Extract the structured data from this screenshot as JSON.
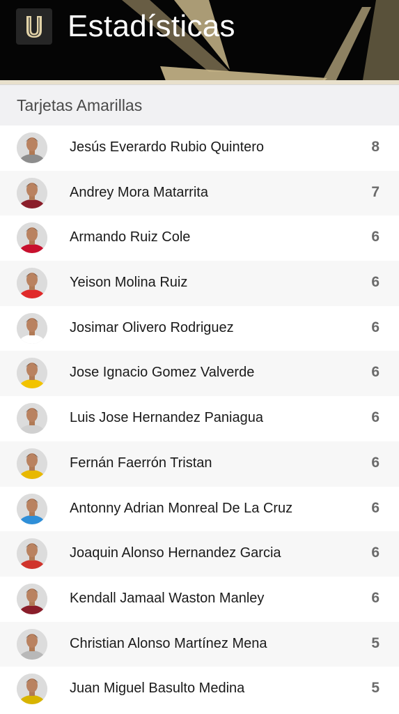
{
  "header": {
    "title": "Estadísticas",
    "logo_letter": "U",
    "background": "#050505",
    "accent": "#c8b68a"
  },
  "section": {
    "title": "Tarjetas Amarillas"
  },
  "players": [
    {
      "name": "Jesús Everardo Rubio Quintero",
      "count": "8",
      "jersey": "#8d8d8d"
    },
    {
      "name": "Andrey Mora Matarrita",
      "count": "7",
      "jersey": "#8a1e2a"
    },
    {
      "name": "Armando Ruiz Cole",
      "count": "6",
      "jersey": "#c8102e"
    },
    {
      "name": "Yeison Molina Ruiz",
      "count": "6",
      "jersey": "#e02a2a"
    },
    {
      "name": "Josimar Olivero Rodriguez",
      "count": "6",
      "jersey": "#ffffff"
    },
    {
      "name": "Jose Ignacio Gomez Valverde",
      "count": "6",
      "jersey": "#f2c300"
    },
    {
      "name": "Luis Jose Hernandez Paniagua",
      "count": "6",
      "jersey": "#d0d0d0"
    },
    {
      "name": "Fernán Faerrón Tristan",
      "count": "6",
      "jersey": "#e8b800"
    },
    {
      "name": "Antonny Adrian Monreal De La Cruz",
      "count": "6",
      "jersey": "#2f8fd8"
    },
    {
      "name": "Joaquin Alonso Hernandez Garcia",
      "count": "6",
      "jersey": "#d0342c"
    },
    {
      "name": "Kendall Jamaal Waston Manley",
      "count": "6",
      "jersey": "#8a1e2a"
    },
    {
      "name": "Christian Alonso Martínez Mena",
      "count": "5",
      "jersey": "#b8b8b8"
    },
    {
      "name": "Juan Miguel Basulto Medina",
      "count": "5",
      "jersey": "#d8b400"
    }
  ]
}
